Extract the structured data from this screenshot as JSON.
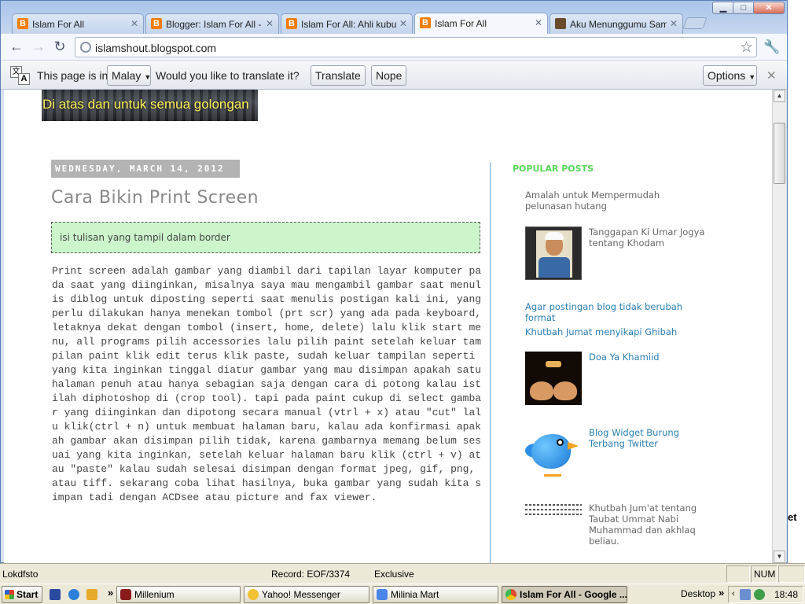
{
  "browser": {
    "tabs": [
      {
        "title": "Islam For All",
        "icon": "blogger-icon"
      },
      {
        "title": "Blogger: Islam For All - Se",
        "icon": "blogger-icon"
      },
      {
        "title": "Islam For All: Ahli kubur di",
        "icon": "blogger-icon"
      },
      {
        "title": "Islam For All",
        "icon": "blogger-icon",
        "active": true
      },
      {
        "title": "Aku Menunggumu Sampai",
        "icon": "profile-icon"
      }
    ],
    "url": "islamshout.blogspot.com",
    "window_controls": {
      "minimize": "▁",
      "maximize": "□",
      "close": "✕"
    }
  },
  "translate_bar": {
    "page_is_in": "This page is in",
    "language": "Malay",
    "question": "Would you like to translate it?",
    "translate_label": "Translate",
    "nope_label": "Nope",
    "options_label": "Options"
  },
  "blog": {
    "tagline": "Di atas dan untuk semua golongan",
    "date_header": "WEDNESDAY, MARCH 14, 2012",
    "post_title": "Cara Bikin Print Screen",
    "border_box_text": "isi tulisan yang tampil dalam border",
    "post_body": "Print screen adalah gambar yang diambil dari tapilan layar komputer pada saat yang diinginkan, misalnya saya mau mengambil gambar saat menulis diblog untuk diposting seperti saat menulis postigan kali ini, yang perlu dilakukan hanya menekan tombol (prt scr) yang ada pada keyboard, letaknya dekat dengan tombol (insert, home, delete) lalu klik start menu, all programs pilih accessories lalu pilih paint setelah keluar tampilan paint klik edit terus klik paste, sudah keluar tampilan seperti yang kita inginkan tinggal diatur gambar yang mau disimpan apakah satu halaman penuh atau hanya sebagian saja dengan cara di potong kalau istilah diphotoshop di (crop tool). tapi pada paint cukup di select gambar yang diinginkan dan dipotong secara manual (vtrl + x) atau \"cut\" lalu klik(ctrl + n) untuk membuat halaman baru, kalau ada konfirmasi apakah gambar akan disimpan pilih tidak, karena gambarnya memang belum sesuai yang kita inginkan, setelah keluar halaman baru klik (ctrl + v) atau \"paste\" kalau sudah selesai disimpan dengan format jpeg, gif, png, atau tiff. sekarang coba lihat hasilnya, buka gambar yang sudah kita simpan tadi dengan ACDsee atau picture and fax viewer.",
    "popular_posts": {
      "heading": "POPULAR POSTS",
      "items": [
        {
          "title": "Amalah untuk Mempermudah pelunasan hutang"
        },
        {
          "title": "Tanggapan Ki Umar Jogya tentang Khodam"
        },
        {
          "title": "Agar postingan blog tidak berubah format"
        },
        {
          "title": "Khutbah Jumat menyikapi Ghibah"
        },
        {
          "title": "Doa Ya Khamiid"
        },
        {
          "title": "Blog Widget Burung Terbang Twitter"
        },
        {
          "title": "Khutbah Jum'at tentang Taubat Ummat Nabi Muhammad dan akhlaq beliau."
        }
      ]
    }
  },
  "background_app": {
    "status_left": "Lokdfsto",
    "status_record": "Record: EOF/3374",
    "status_mode": "Exclusive",
    "status_num": "NUM",
    "side_text": "et"
  },
  "taskbar": {
    "start_label": "Start",
    "tasks": [
      {
        "label": "Millenium",
        "color": "#8b1a1a"
      },
      {
        "label": "Yahoo! Messenger",
        "color": "#f1c232"
      },
      {
        "label": "Milinia Mart",
        "color": "#4a86e8"
      },
      {
        "label": "Islam For All - Google ...",
        "color": "#e04a2f",
        "active": true
      }
    ],
    "desktop_label": "Desktop",
    "chevron": "»",
    "clock": "18:48"
  }
}
